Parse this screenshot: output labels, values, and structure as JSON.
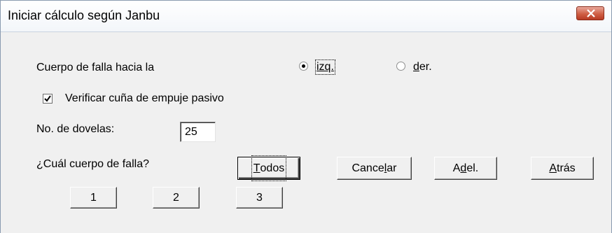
{
  "window": {
    "title": "Iniciar cálculo según Janbu"
  },
  "direction": {
    "label": "Cuerpo de falla hacia la",
    "options": [
      {
        "label": "izq.",
        "selected": true
      },
      {
        "label": "der.",
        "selected": false
      }
    ]
  },
  "passive_wedge": {
    "label": "Verificar cuña de empuje pasivo",
    "checked": true
  },
  "slices": {
    "label": "No. de dovelas:",
    "value": "25"
  },
  "failure_body": {
    "label": "¿Cuál cuerpo de falla?"
  },
  "buttons": {
    "all": "Todos",
    "cancel": "Cancelar",
    "next": "Adel.",
    "back": "Atrás",
    "body_1": "1",
    "body_2": "2",
    "body_3": "3"
  },
  "icons": {
    "close": "close-icon",
    "check": "check-icon"
  }
}
